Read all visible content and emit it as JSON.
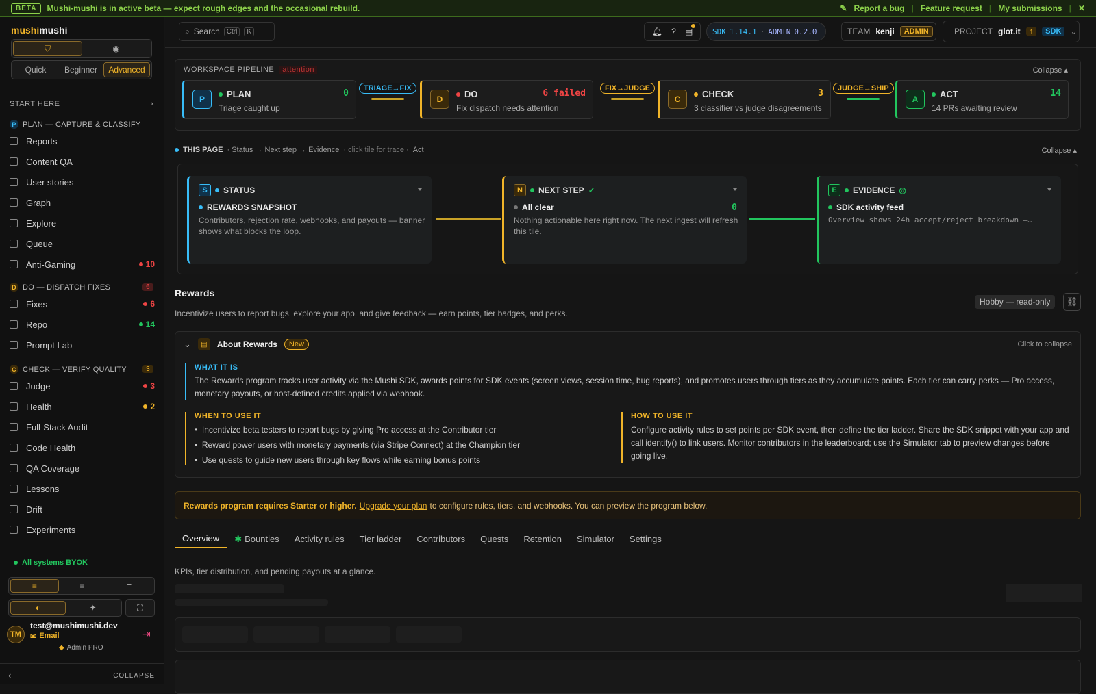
{
  "banner": {
    "tag": "BETA",
    "message": "Mushi-mushi is in active beta — expect rough edges and the occasional rebuild.",
    "report_bug": "Report a bug",
    "feature_request": "Feature request",
    "my_submissions": "My submissions",
    "close": "✕"
  },
  "brand": {
    "part1": "mushi",
    "part2": "mushi"
  },
  "modes": [
    "Quick",
    "Beginner",
    "Advanced"
  ],
  "sidebar": {
    "start_here": "START HERE",
    "plan_title": "PLAN — CAPTURE & CLASSIFY",
    "plan_items": [
      {
        "label": "Reports"
      },
      {
        "label": "Content QA"
      },
      {
        "label": "User stories"
      },
      {
        "label": "Graph"
      },
      {
        "label": "Explore"
      },
      {
        "label": "Queue"
      },
      {
        "label": "Anti-Gaming",
        "count": "10",
        "color": "#ef4444"
      }
    ],
    "do_title": "DO — DISPATCH FIXES",
    "do_count": "6",
    "do_items": [
      {
        "label": "Fixes",
        "count": "6",
        "color": "#ef4444"
      },
      {
        "label": "Repo",
        "count": "14",
        "color": "#22c55e"
      },
      {
        "label": "Prompt Lab"
      }
    ],
    "check_title": "CHECK — VERIFY QUALITY",
    "check_count": "3",
    "check_items": [
      {
        "label": "Judge",
        "count": "3",
        "color": "#ef4444"
      },
      {
        "label": "Health",
        "count": "2",
        "color": "#f0b429"
      },
      {
        "label": "Full-Stack Audit"
      },
      {
        "label": "Code Health"
      },
      {
        "label": "QA Coverage"
      },
      {
        "label": "Lessons"
      },
      {
        "label": "Drift"
      },
      {
        "label": "Experiments"
      }
    ],
    "status": "All systems BYOK",
    "user_initials": "TM",
    "user_email": "test@mushimushi.dev",
    "user_method": "Email",
    "user_plan": "Admin PRO",
    "collapse": "COLLAPSE"
  },
  "topbar": {
    "search": "Search",
    "kbd1": "Ctrl",
    "kbd2": "K",
    "help": "?",
    "sdk_label": "SDK",
    "sdk_version": "1.14.1",
    "sep": "·",
    "admin_label": "ADMIN",
    "admin_version": "0.2.0",
    "team_label": "TEAM",
    "team_name": "kenji",
    "team_role": "ADMIN",
    "project_label": "PROJECT",
    "project_name": "glot.it",
    "project_up": "↑",
    "project_sdk": "SDK"
  },
  "pipeline": {
    "title": "WORKSPACE PIPELINE",
    "flag": "attention",
    "collapse": "Collapse ▴",
    "stages": [
      {
        "letter": "P",
        "name": "PLAN",
        "desc": "Triage caught up",
        "count": "0",
        "color": "#38bdf8",
        "dot": "#22c55e",
        "count_color": "#22c55e"
      },
      {
        "letter": "D",
        "name": "DO",
        "desc": "Fix dispatch needs attention",
        "count": "6 failed",
        "color": "#f0b429",
        "dot": "#ef4444",
        "count_color": "#ef4444"
      },
      {
        "letter": "C",
        "name": "CHECK",
        "desc": "3 classifier vs judge disagreements",
        "count": "3",
        "color": "#f0b429",
        "dot": "#f0b429",
        "count_color": "#f0b429"
      },
      {
        "letter": "A",
        "name": "ACT",
        "desc": "14 PRs awaiting review",
        "count": "14",
        "color": "#22c55e",
        "dot": "#22c55e",
        "count_color": "#22c55e"
      }
    ],
    "connectors": [
      {
        "label": "TRIAGE→FIX",
        "color": "#38bdf8",
        "line": "#c9a227"
      },
      {
        "label": "FIX→JUDGE",
        "color": "#f0b429",
        "line": "#c9a227"
      },
      {
        "label": "JUDGE→SHIP",
        "color": "#f0b429",
        "line": "#22c55e"
      }
    ]
  },
  "this_page": {
    "title": "THIS PAGE",
    "crumbs": "· Status → Next step → Evidence",
    "hint": "· click tile for trace ·",
    "act": "Act",
    "collapse": "Collapse ▴",
    "tiles": [
      {
        "letter": "S",
        "name": "STATUS",
        "check": "",
        "sub": "REWARDS SNAPSHOT",
        "count": "",
        "body": "Contributors, rejection rate, webhooks, and payouts — banner shows what blocks the loop.",
        "color": "#38bdf8"
      },
      {
        "letter": "N",
        "name": "NEXT STEP",
        "check": "✓",
        "sub": "All clear",
        "count": "0",
        "body": "Nothing actionable here right now. The next ingest will refresh this tile.",
        "color": "#f0b429"
      },
      {
        "letter": "E",
        "name": "EVIDENCE",
        "check": "◎",
        "sub": "SDK activity feed",
        "count": "",
        "body": "Overview shows 24h accept/reject breakdown —…",
        "color": "#22c55e"
      }
    ]
  },
  "rewards": {
    "title": "Rewards",
    "subtitle": "Incentivize users to report bugs, explore your app, and give feedback — earn points, tier badges, and perks.",
    "plan_badge": "Hobby — read-only",
    "about_title": "About Rewards",
    "about_new": "New",
    "about_collapse": "Click to collapse",
    "what_title": "WHAT IT IS",
    "what_body": "The Rewards program tracks user activity via the Mushi SDK, awards points for SDK events (screen views, session time, bug reports), and promotes users through tiers as they accumulate points. Each tier can carry perks — Pro access, monetary payouts, or host-defined credits applied via webhook.",
    "when_title": "WHEN TO USE IT",
    "when_items": [
      "Incentivize beta testers to report bugs by giving Pro access at the Contributor tier",
      "Reward power users with monetary payments (via Stripe Connect) at the Champion tier",
      "Use quests to guide new users through key flows while earning bonus points"
    ],
    "how_title": "HOW TO USE IT",
    "how_body": "Configure activity rules to set points per SDK event, then define the tier ladder. Share the SDK snippet with your app and call identify() to link users. Monitor contributors in the leaderboard; use the Simulator tab to preview changes before going live.",
    "upgrade_bold": "Rewards program requires Starter or higher.",
    "upgrade_link": "Upgrade your plan",
    "upgrade_rest": "to configure rules, tiers, and webhooks. You can preview the program below.",
    "tabs": [
      "Overview",
      "Bounties",
      "Activity rules",
      "Tier ladder",
      "Contributors",
      "Quests",
      "Retention",
      "Simulator",
      "Settings"
    ],
    "tab_caption": "KPIs, tier distribution, and pending payouts at a glance."
  },
  "colors": {
    "accent": "#f0b429",
    "plan": "#38bdf8",
    "ok": "#22c55e",
    "danger": "#ef4444"
  }
}
